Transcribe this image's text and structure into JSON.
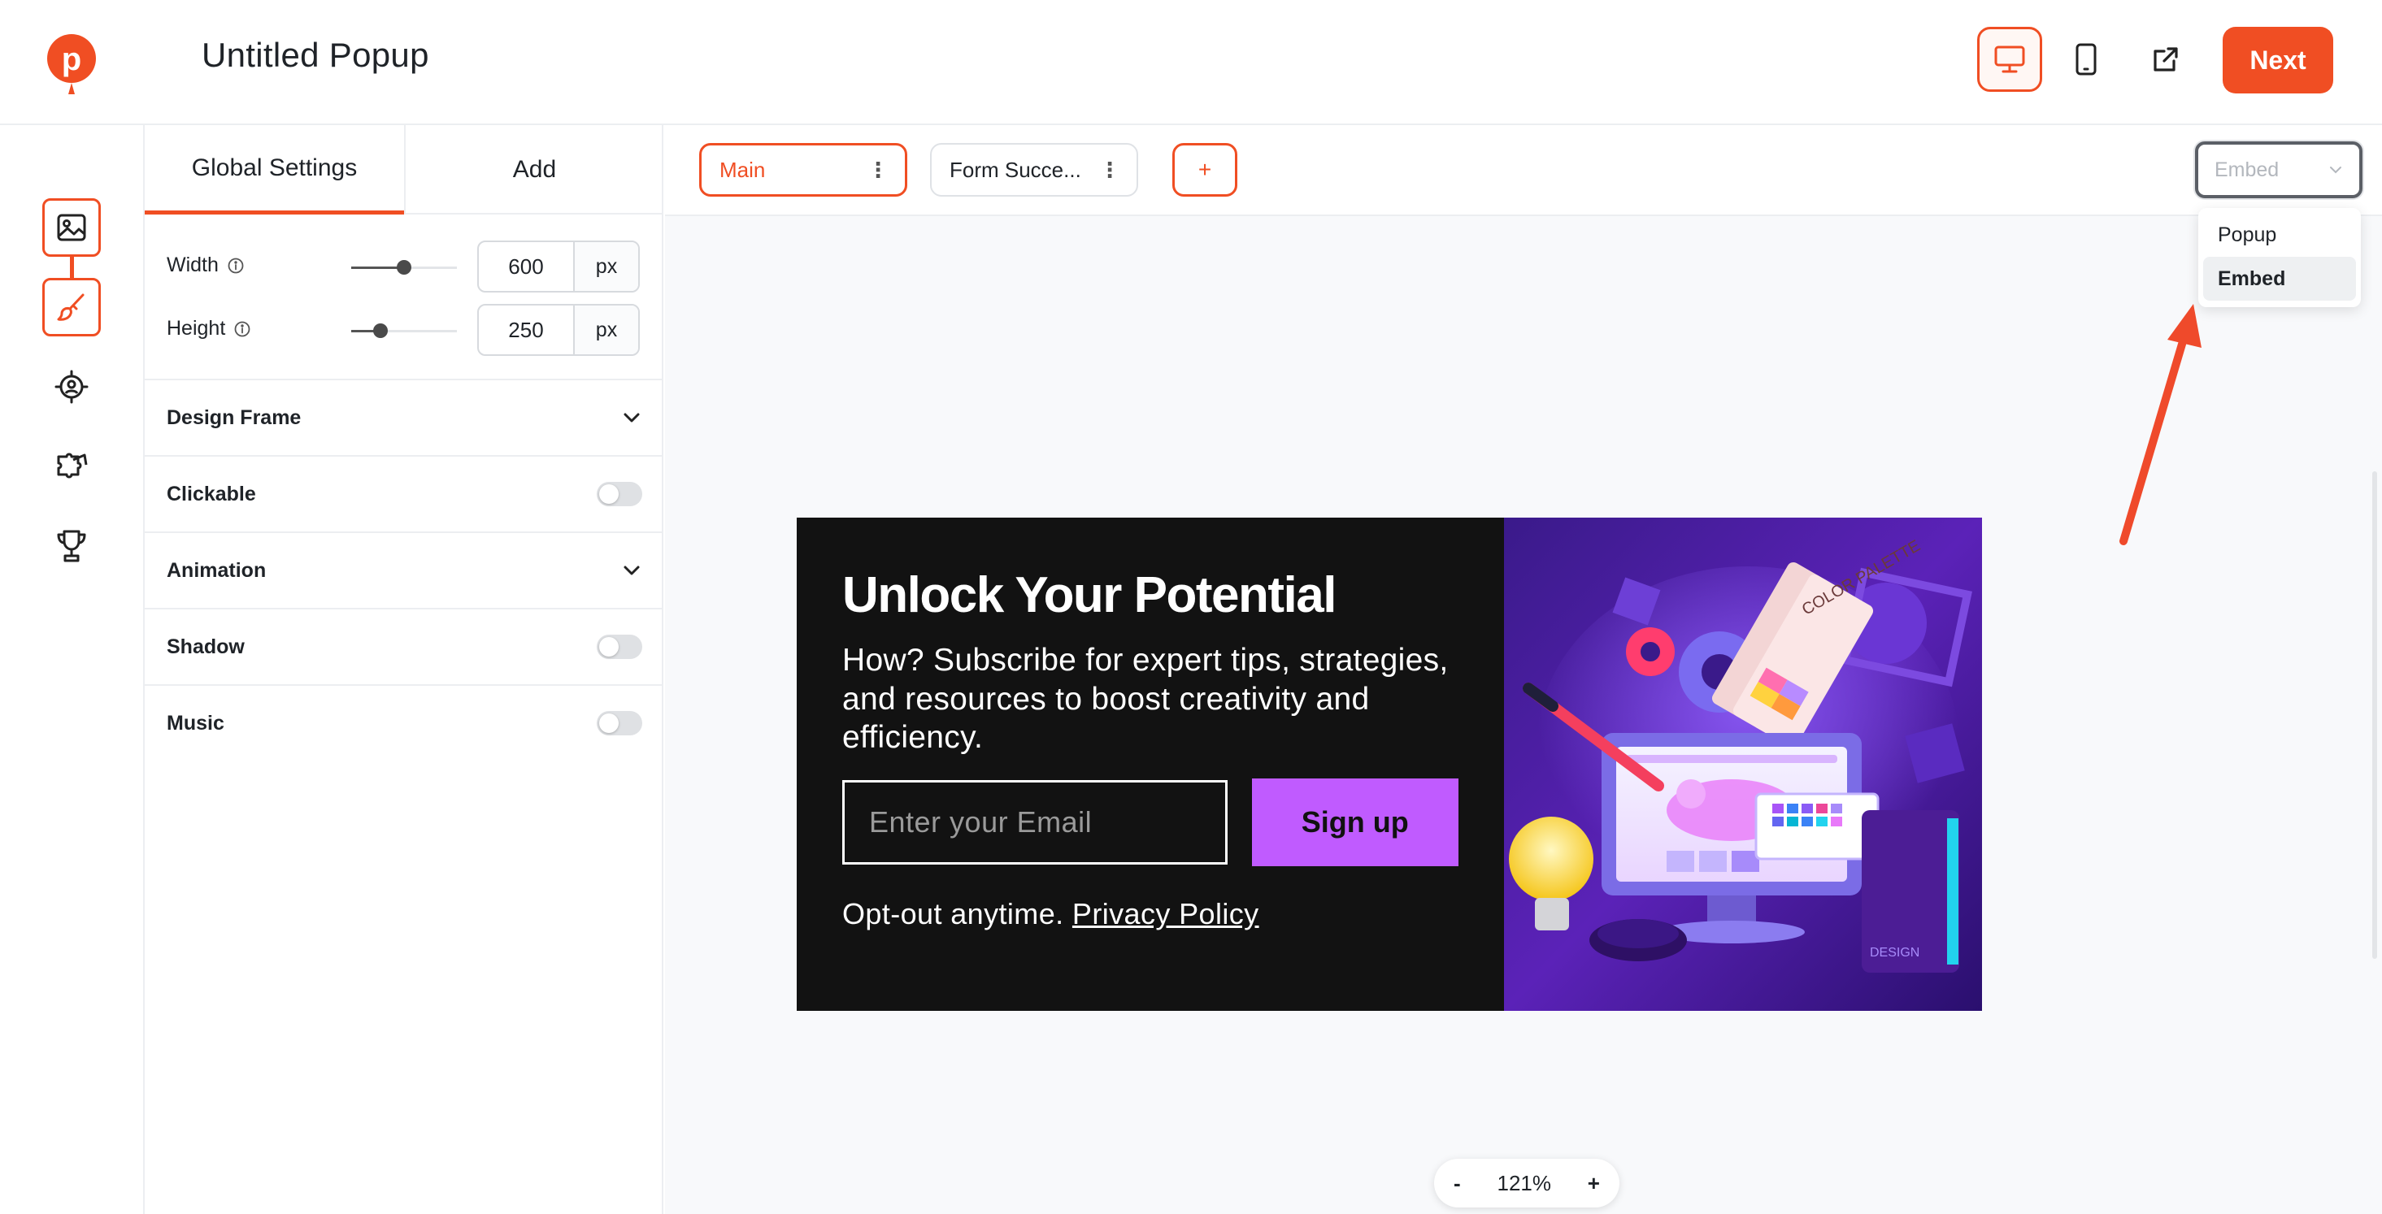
{
  "header": {
    "title": "Untitled Popup",
    "next_label": "Next"
  },
  "panel": {
    "tabs": [
      {
        "label": "Global Settings",
        "active": true
      },
      {
        "label": "Add",
        "active": false
      }
    ],
    "width": {
      "label": "Width",
      "value": "600",
      "unit": "px"
    },
    "height": {
      "label": "Height",
      "value": "250",
      "unit": "px"
    },
    "sections": {
      "design_frame": "Design Frame",
      "clickable": "Clickable",
      "animation": "Animation",
      "shadow": "Shadow",
      "music": "Music"
    }
  },
  "steps": {
    "main": "Main",
    "success": "Form Succe...",
    "add": "+"
  },
  "mode_select": {
    "placeholder": "Embed",
    "options": [
      "Popup",
      "Embed"
    ],
    "selected": "Embed"
  },
  "popup": {
    "heading": "Unlock Your Potential",
    "body": "How? Subscribe for expert tips, strategies, and resources to boost creativity and efficiency.",
    "email_placeholder": "Enter your Email",
    "signup_label": "Sign up",
    "optout_text": "Opt-out anytime.",
    "privacy_link": "Privacy Policy",
    "illustration_text": "COLOR PALETTE",
    "illustration_text2": "DESIGN"
  },
  "zoom": {
    "minus": "-",
    "level": "121%",
    "plus": "+"
  },
  "colors": {
    "accent": "#f04e23",
    "popup_bg": "#121212",
    "button": "#c05bff"
  }
}
